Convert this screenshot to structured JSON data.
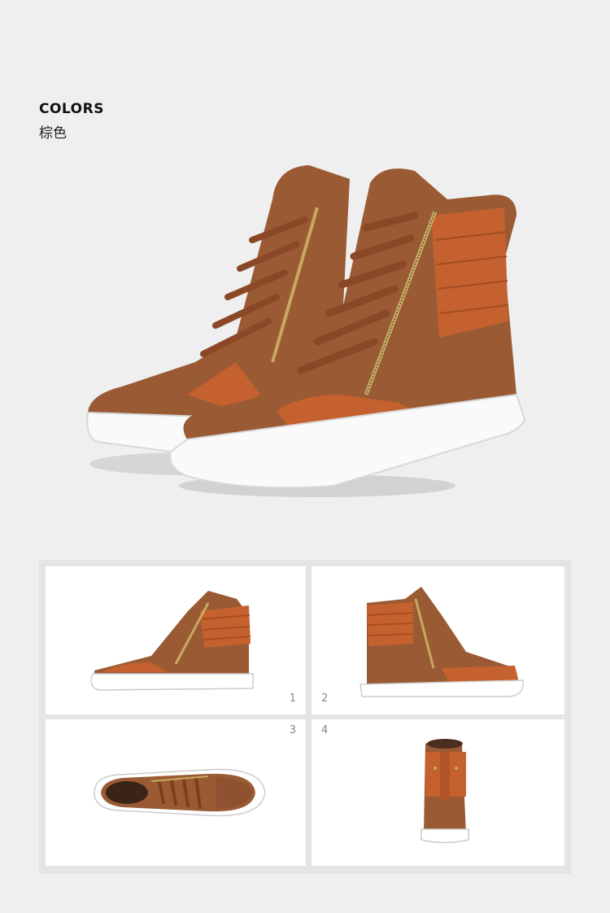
{
  "header": {
    "title": "COLORS",
    "color_name": "棕色"
  },
  "palette": {
    "nubuck": "#9a5a34",
    "leather": "#c4612e",
    "sole": "#ffffff",
    "zipper": "#c9a862",
    "background": "#efefef"
  },
  "gallery": {
    "views": [
      {
        "label": "1",
        "icon": "side-view"
      },
      {
        "label": "2",
        "icon": "inner-side-view"
      },
      {
        "label": "3",
        "icon": "top-view"
      },
      {
        "label": "4",
        "icon": "back-view"
      }
    ]
  }
}
